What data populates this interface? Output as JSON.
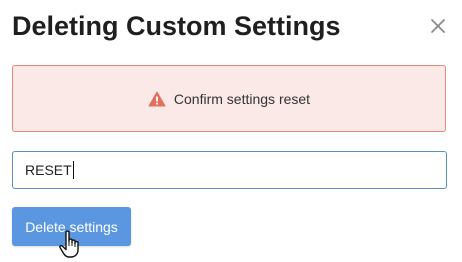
{
  "dialog": {
    "title": "Deleting Custom Settings",
    "close_icon": "close-icon"
  },
  "alert": {
    "icon": "warning-icon",
    "text": "Confirm settings reset",
    "icon_color": "#e07060"
  },
  "input": {
    "value": "RESET"
  },
  "actions": {
    "delete_label": "Delete settings",
    "delete_color": "#5b97e0"
  },
  "pointer": {
    "icon": "hand-pointer-icon"
  }
}
